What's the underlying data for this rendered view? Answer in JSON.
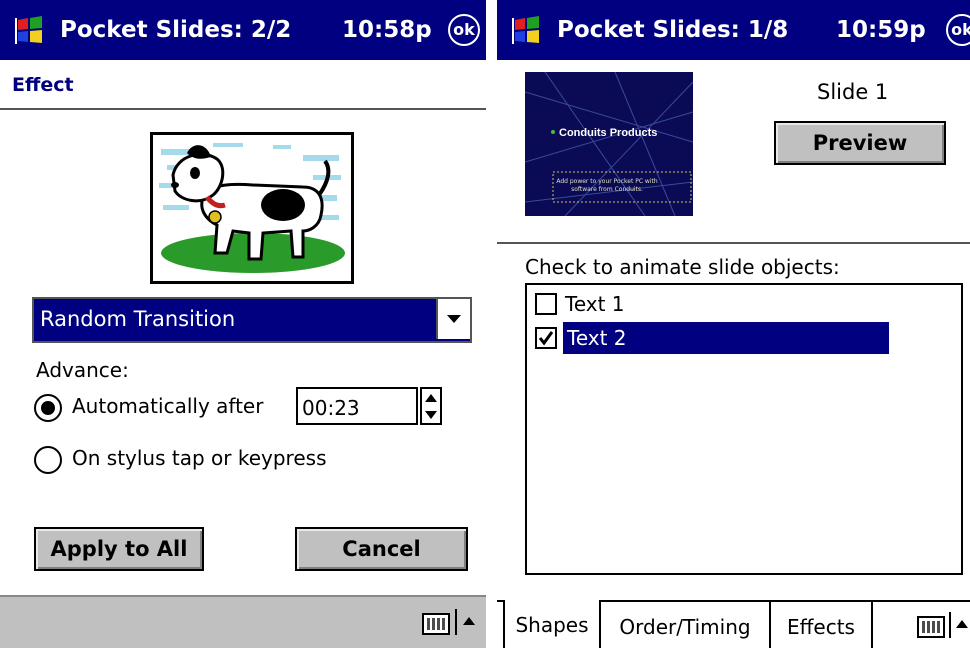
{
  "left": {
    "title": "Pocket Slides: 2/2",
    "clock": "10:58p",
    "ok": "ok",
    "section": "Effect",
    "transition": "Random Transition",
    "advance_label": "Advance:",
    "auto_label": "Automatically after",
    "auto_time": "00:23",
    "tap_label": "On stylus tap or keypress",
    "apply_button": "Apply to All",
    "cancel_button": "Cancel",
    "selected_option": "Automatically after"
  },
  "right": {
    "title": "Pocket Slides: 1/8",
    "clock": "10:59p",
    "ok": "ok",
    "thumb_title": "Conduits Products",
    "thumb_subtitle": "Add power to your Pocket PC with software from Conduits.",
    "slide_label": "Slide 1",
    "preview_button": "Preview",
    "animate_label": "Check to animate slide objects:",
    "objects": [
      {
        "label": "Text 1",
        "checked": false,
        "selected": false
      },
      {
        "label": "Text 2",
        "checked": true,
        "selected": true
      }
    ],
    "tabs": [
      "Shapes",
      "Order/Timing",
      "Effects"
    ],
    "active_tab": "Shapes"
  },
  "colors": {
    "titlebar": "#000080",
    "selection": "#000080",
    "button_face": "#c0c0c0",
    "thumb_background": "#0c0c5a"
  },
  "icons": [
    "windows-flag-icon",
    "keyboard-icon",
    "sip-up-arrow-icon",
    "dog-picture",
    "radio-selected-icon",
    "spinner-icon",
    "checkbox-icon"
  ]
}
